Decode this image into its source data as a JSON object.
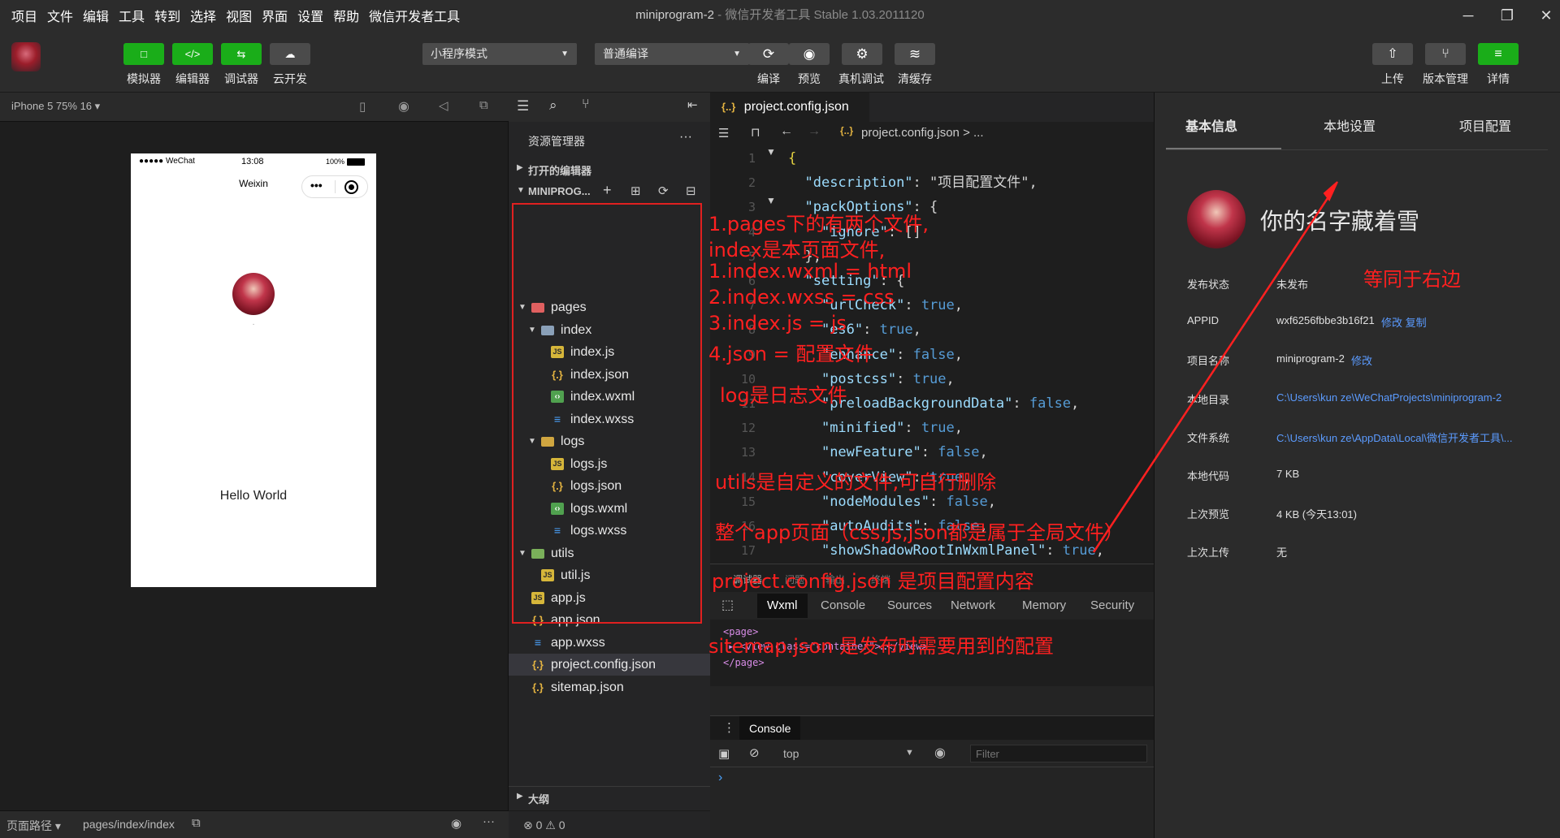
{
  "menu": [
    "项目",
    "文件",
    "编辑",
    "工具",
    "转到",
    "选择",
    "视图",
    "界面",
    "设置",
    "帮助",
    "微信开发者工具"
  ],
  "window_title": {
    "project": "miniprogram-2",
    "app": " - 微信开发者工具 Stable 1.03.2011120"
  },
  "toolbar": {
    "left_buttons": [
      {
        "label": "模拟器",
        "icon": "□"
      },
      {
        "label": "编辑器",
        "icon": "</>"
      },
      {
        "label": "调试器",
        "icon": "⇆"
      },
      {
        "label": "云开发",
        "icon": "☁"
      }
    ],
    "mode_select": "小程序模式",
    "compile_select": "普通编译",
    "center_buttons": [
      {
        "label": "编译",
        "icon": "⟳"
      },
      {
        "label": "预览",
        "icon": "◉"
      },
      {
        "label": "真机调试",
        "icon": "⚙"
      },
      {
        "label": "清缓存",
        "icon": "≋"
      }
    ],
    "right_buttons": [
      {
        "label": "上传",
        "icon": "⇧"
      },
      {
        "label": "版本管理",
        "icon": "⑂"
      },
      {
        "label": "详情",
        "icon": "≡"
      }
    ]
  },
  "simulator": {
    "device": "iPhone 5 75% 16 ▾",
    "status_left": "●●●●● WeChat",
    "status_time": "13:08",
    "status_battery": "100%",
    "nav_title": "Weixin",
    "nav_more": "•••",
    "dot_text": "·",
    "hello": "Hello World",
    "path_label": "页面路径 ▾",
    "path_value": "pages/index/index"
  },
  "explorer": {
    "title": "资源管理器",
    "more": "···",
    "open_editors": "打开的编辑器",
    "project": "MINIPROG...",
    "outline": "大纲",
    "status": "⊗ 0 ⚠ 0",
    "tree": [
      {
        "name": "pages",
        "type": "folder-red",
        "level": 0,
        "open": true
      },
      {
        "name": "index",
        "type": "folder-open",
        "level": 1,
        "open": true
      },
      {
        "name": "index.js",
        "type": "js",
        "level": 2
      },
      {
        "name": "index.json",
        "type": "json",
        "level": 2
      },
      {
        "name": "index.wxml",
        "type": "wxml",
        "level": 2
      },
      {
        "name": "index.wxss",
        "type": "wxss",
        "level": 2
      },
      {
        "name": "logs",
        "type": "folder",
        "level": 1,
        "open": true
      },
      {
        "name": "logs.js",
        "type": "js",
        "level": 2
      },
      {
        "name": "logs.json",
        "type": "json",
        "level": 2
      },
      {
        "name": "logs.wxml",
        "type": "wxml",
        "level": 2
      },
      {
        "name": "logs.wxss",
        "type": "wxss",
        "level": 2
      },
      {
        "name": "utils",
        "type": "folder-green",
        "level": 0,
        "open": true
      },
      {
        "name": "util.js",
        "type": "js",
        "level": 1
      },
      {
        "name": "app.js",
        "type": "js",
        "level": 0
      },
      {
        "name": "app.json",
        "type": "json",
        "level": 0
      },
      {
        "name": "app.wxss",
        "type": "wxss",
        "level": 0
      },
      {
        "name": "project.config.json",
        "type": "json",
        "level": 0,
        "selected": true
      },
      {
        "name": "sitemap.json",
        "type": "json",
        "level": 0
      }
    ]
  },
  "editor": {
    "tab": "project.config.json",
    "crumb": "project.config.json > ...",
    "lines": [
      {
        "n": "1",
        "c": "{"
      },
      {
        "n": "2",
        "c": "  \"description\": \"项目配置文件\","
      },
      {
        "n": "3",
        "c": "  \"packOptions\": {"
      },
      {
        "n": "4",
        "c": "    \"ignore\": []"
      },
      {
        "n": "5",
        "c": "  },"
      },
      {
        "n": "6",
        "c": "  \"setting\": {"
      },
      {
        "n": "7",
        "c": "    \"urlCheck\": true,"
      },
      {
        "n": "8",
        "c": "    \"es6\": true,"
      },
      {
        "n": "9",
        "c": "    \"enhance\": false,"
      },
      {
        "n": "10",
        "c": "    \"postcss\": true,"
      },
      {
        "n": "11",
        "c": "    \"preloadBackgroundData\": false,"
      },
      {
        "n": "12",
        "c": "    \"minified\": true,"
      },
      {
        "n": "13",
        "c": "    \"newFeature\": false,"
      },
      {
        "n": "14",
        "c": "    \"coverView\": true,"
      },
      {
        "n": "15",
        "c": "    \"nodeModules\": false,"
      },
      {
        "n": "16",
        "c": "    \"autoAudits\": false,"
      },
      {
        "n": "17",
        "c": "    \"showShadowRootInWxmlPanel\": true,"
      }
    ]
  },
  "devtools": {
    "top_tabs": [
      "调试器",
      "问题",
      "输出",
      "终端"
    ],
    "tabs": [
      "Wxml",
      "Console",
      "Sources",
      "Network",
      "Memory",
      "Security"
    ],
    "wxml": [
      "<page>",
      "▸ <view class=\"container\">…</view>",
      "</page>"
    ],
    "console_tab": "Console",
    "context": "top",
    "filter_placeholder": "Filter",
    "prompt": "›"
  },
  "details": {
    "tabs": [
      "基本信息",
      "本地设置",
      "项目配置"
    ],
    "username": "你的名字藏着雪",
    "rows": [
      {
        "label": "发布状态",
        "value": "未发布"
      },
      {
        "label": "APPID",
        "value": "wxf6256fbbe3b16f21",
        "links": "修改 复制"
      },
      {
        "label": "项目名称",
        "value": "miniprogram-2",
        "links": "修改"
      },
      {
        "label": "本地目录",
        "value": "C:\\Users\\kun ze\\WeChatProjects\\miniprogram-2",
        "link_value": true
      },
      {
        "label": "文件系统",
        "value": "C:\\Users\\kun ze\\AppData\\Local\\微信开发者工具\\...",
        "link_value": true
      },
      {
        "label": "本地代码",
        "value": "7 KB"
      },
      {
        "label": "上次预览",
        "value": "4 KB (今天13:01)"
      },
      {
        "label": "上次上传",
        "value": "无"
      }
    ]
  },
  "annotations": [
    "1.pages下的有两个文件,",
    "index是本页面文件,",
    "1.index.wxml = html",
    "2.index.wxss = css",
    "3.index.js = js",
    "4.json = 配置文件",
    "log是日志文件",
    "utils是自定义的文件,可自行删除",
    "整个app页面（css,js,json都是属于全局文件）",
    "project.config.json 是项目配置内容",
    "sitemap.json 是发布时需要用到的配置",
    "等同于右边"
  ],
  "colors": {
    "accent_green": "#1aad19",
    "annotation_red": "#ff2020",
    "link_blue": "#5b9bff"
  }
}
